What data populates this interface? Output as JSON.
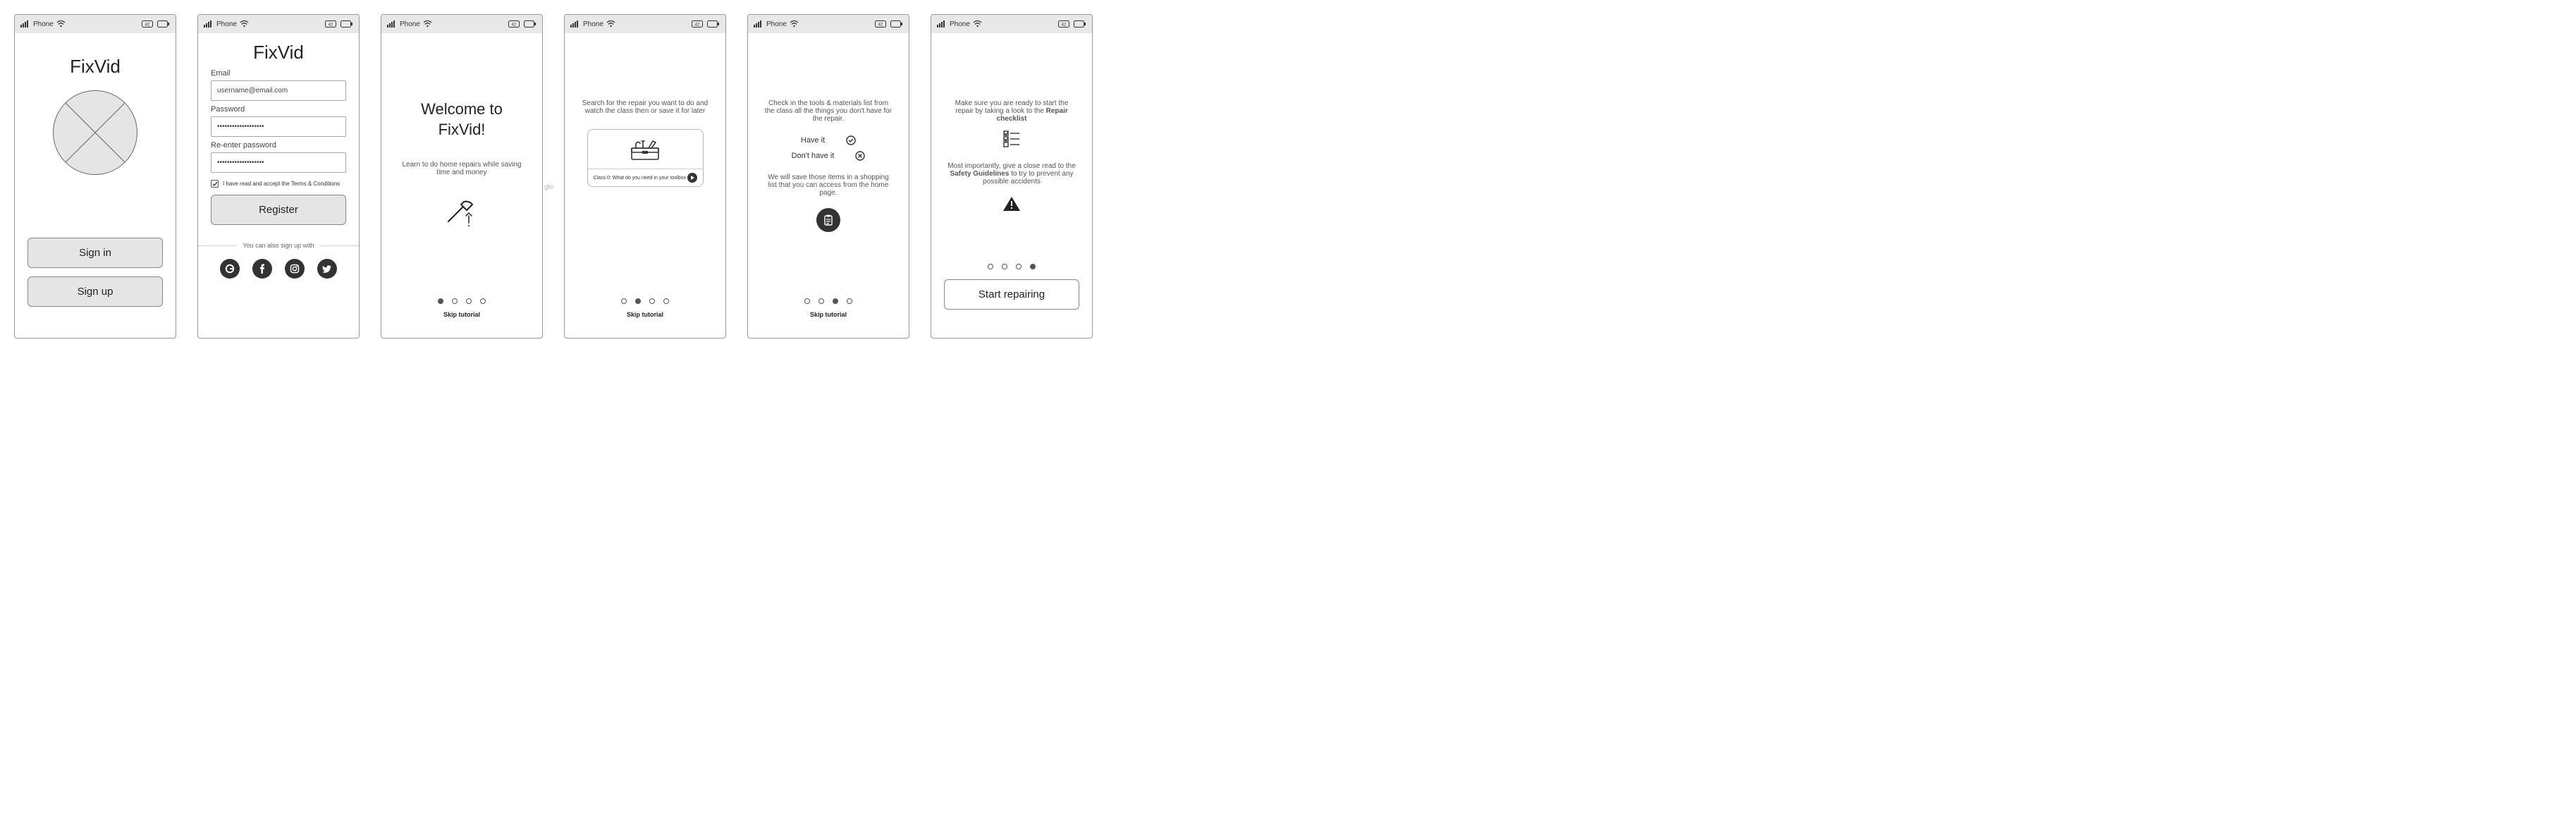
{
  "status": {
    "phone_label": "Phone"
  },
  "screen1": {
    "title": "FixVid",
    "signin": "Sign in",
    "signup": "Sign up"
  },
  "screen2": {
    "title": "FixVid",
    "email_label": "Email",
    "email_value": "username@email.com",
    "password_label": "Password",
    "password_value": "•••••••••••••••••••",
    "repassword_label": "Re-enter password",
    "repassword_value": "•••••••••••••••••••",
    "terms": "I have read and accept the Terms & Conditions",
    "register": "Register",
    "alt_signup": "You can also sign up with"
  },
  "screen3": {
    "title_line1": "Welcome to",
    "title_line2": "FixVid!",
    "subtitle": "Learn to do home repairs while saving time and money",
    "skip": "Skip tutorial"
  },
  "screen4": {
    "subtitle": "Search for the repair you want to do and watch the class then or save it for later",
    "video_caption": "Class 0: What do you need in your toolbox",
    "skip": "Skip tutorial"
  },
  "screen5": {
    "subtitle": "Check in the tools & materials list from the class all the things you don't have for the repair.",
    "have": "Have it",
    "donthave": "Don't have it",
    "shopping_note": "We will save those items in a shopping list that you can access from the home page.",
    "skip": "Skip tutorial"
  },
  "screen6": {
    "line1_a": "Make sure you are ready to start the repair by taking a look to the ",
    "line1_b": "Repair checklist",
    "line2_a": "Most importantly, give a close read to the ",
    "line2_b": "Safety Guidelines",
    "line2_c": " to try to prevent any possible accidents",
    "cta": "Start repairing"
  },
  "stray_text": "gle"
}
